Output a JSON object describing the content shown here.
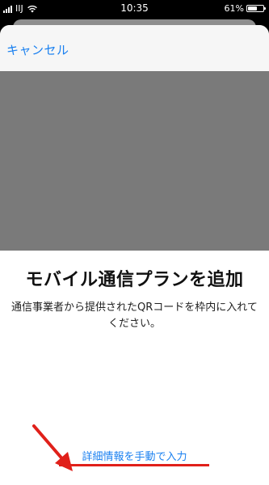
{
  "status_bar": {
    "carrier": "IIJ",
    "time": "10:35",
    "battery_percent": "61%",
    "battery_level": 0.61
  },
  "navbar": {
    "cancel_label": "キャンセル"
  },
  "main": {
    "title": "モバイル通信プランを追加",
    "instruction": "通信事業者から提供されたQRコードを枠内に入れてください。",
    "manual_entry_label": "詳細情報を手動で入力"
  },
  "colors": {
    "link": "#1a80f0",
    "annotation": "#e0201a",
    "camera_placeholder": "#7a7a7a"
  }
}
